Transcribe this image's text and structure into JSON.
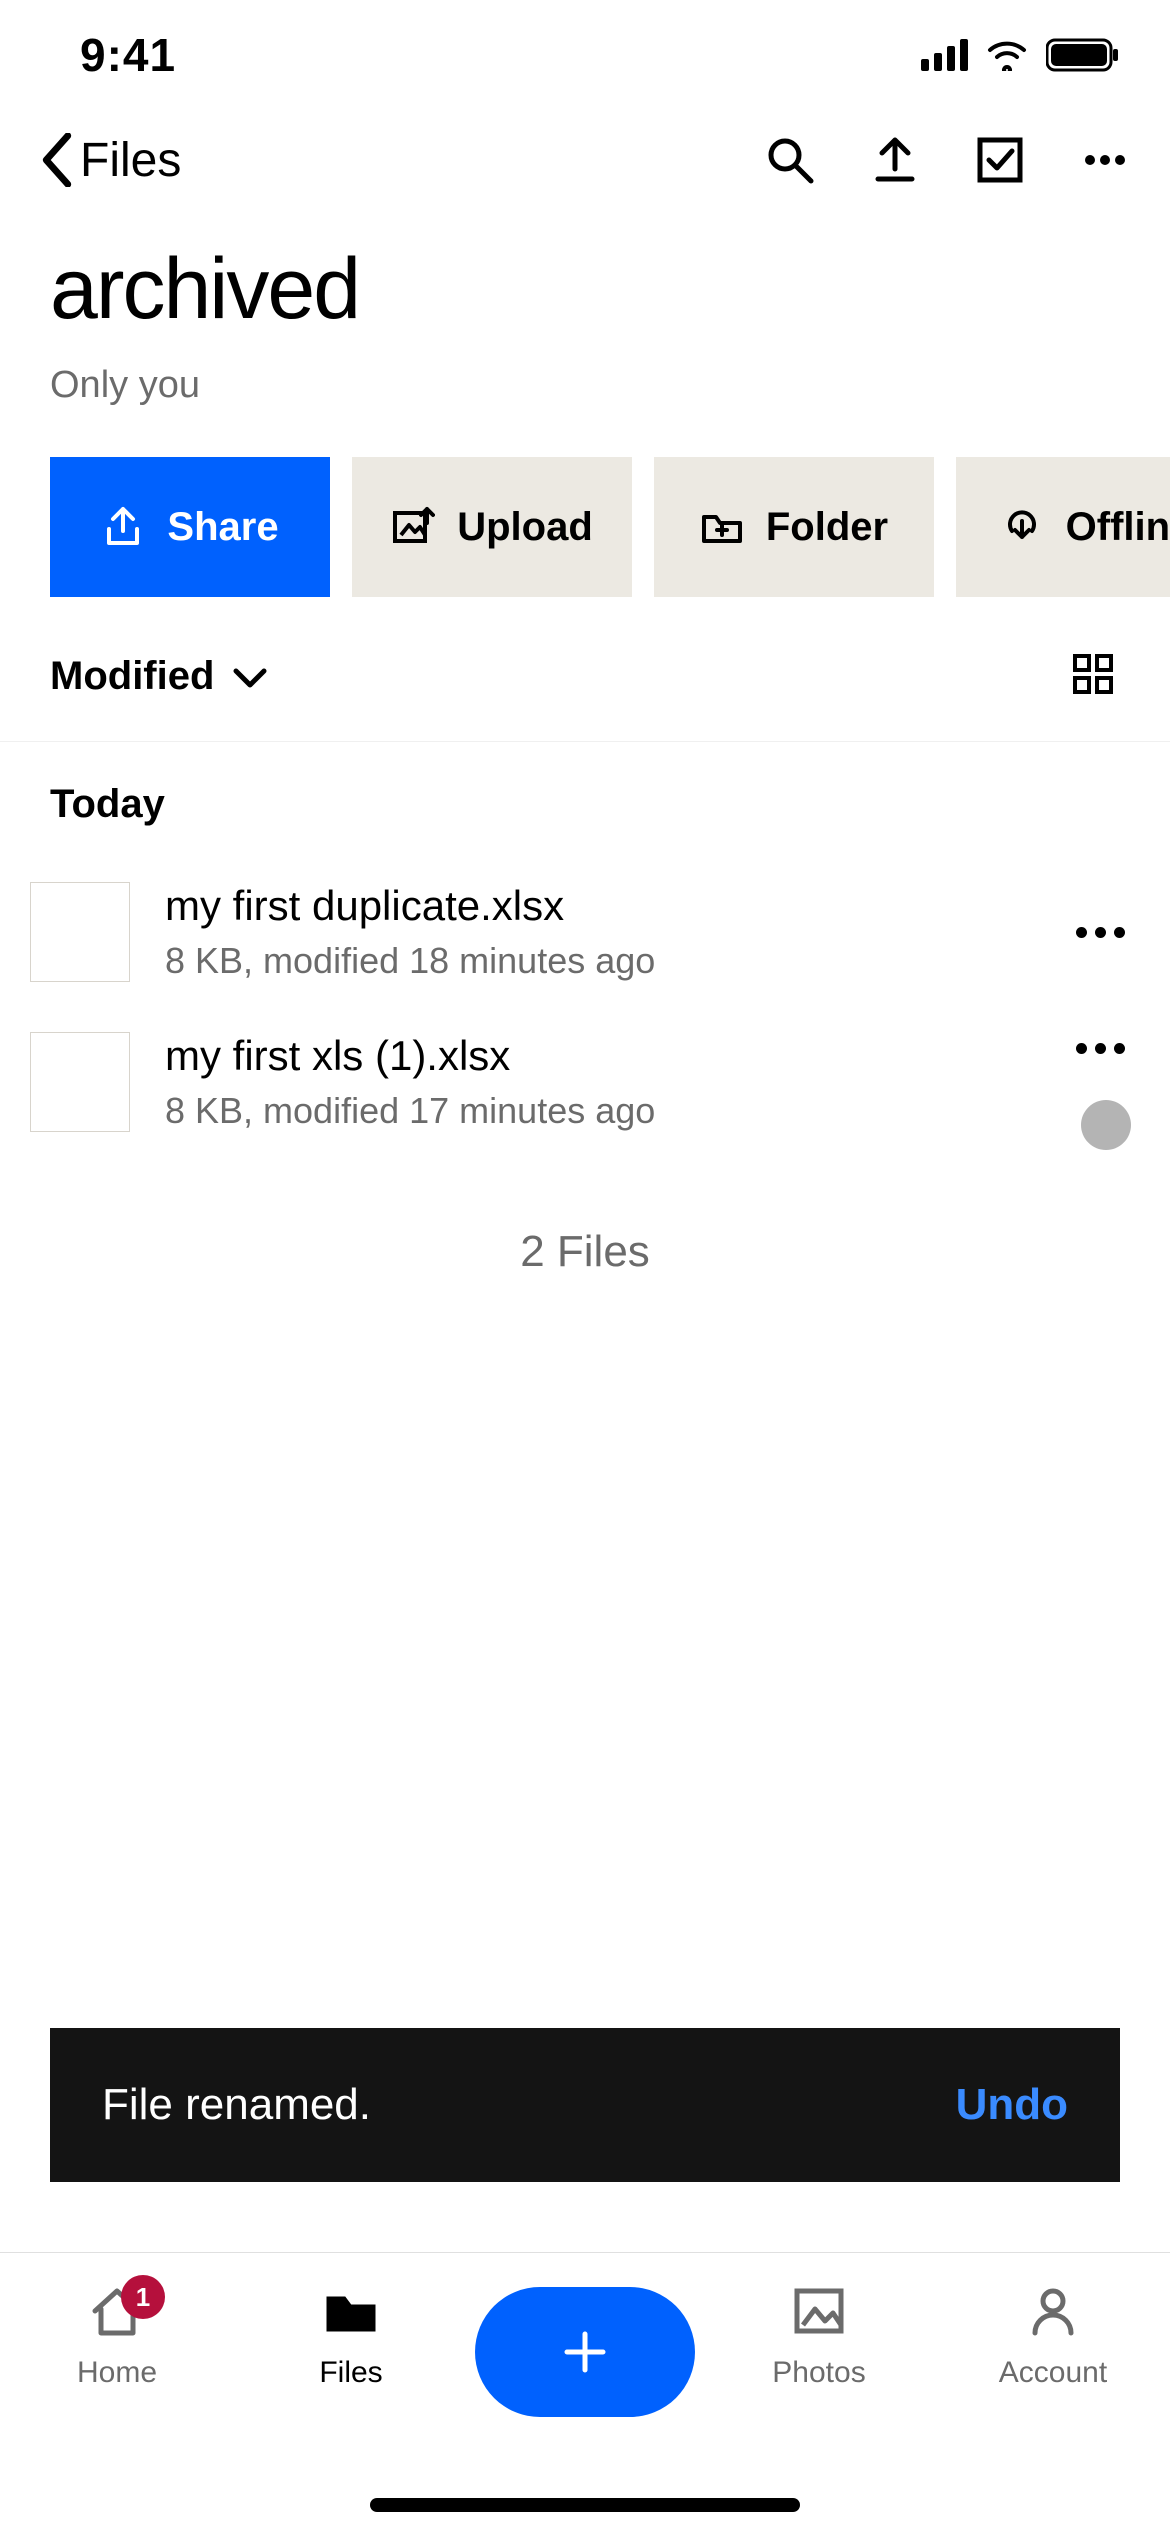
{
  "status": {
    "time": "9:41"
  },
  "nav": {
    "back_label": "Files"
  },
  "folder": {
    "title": "archived",
    "access": "Only you"
  },
  "chips": {
    "share": "Share",
    "upload": "Upload",
    "folder": "Folder",
    "offline": "Offline"
  },
  "sort": {
    "label": "Modified"
  },
  "sections": {
    "today": "Today"
  },
  "files": [
    {
      "name": "my first duplicate.xlsx",
      "meta": "8 KB, modified 18 minutes ago",
      "syncing": false
    },
    {
      "name": "my first xls (1).xlsx",
      "meta": "8 KB, modified 17 minutes ago",
      "syncing": true
    }
  ],
  "summary": {
    "count_text": "2 Files"
  },
  "toast": {
    "message": "File renamed.",
    "action": "Undo"
  },
  "tabs": {
    "home": {
      "label": "Home",
      "badge": "1"
    },
    "files": {
      "label": "Files"
    },
    "photos": {
      "label": "Photos"
    },
    "account": {
      "label": "Account"
    }
  }
}
